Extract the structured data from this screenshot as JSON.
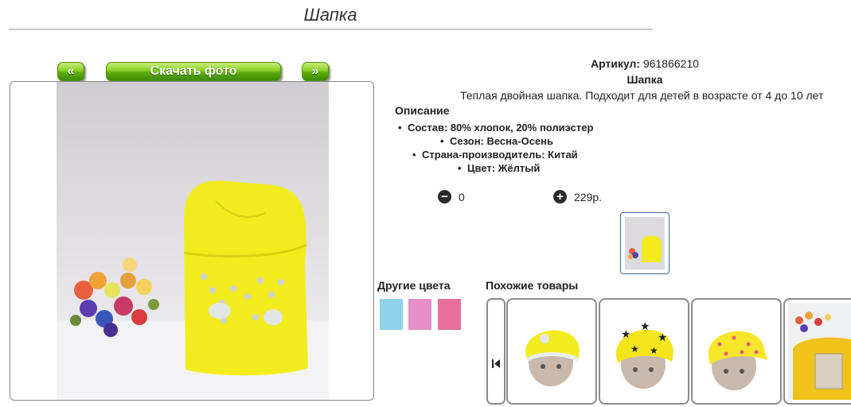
{
  "page": {
    "title": "Шапка"
  },
  "gallery": {
    "prev_label": "«",
    "download_label": "Скачать фото",
    "next_label": "»"
  },
  "product": {
    "article_label": "Артикул:",
    "article_value": "961866210",
    "name": "Шапка",
    "summary": "Теплая двойная шапка. Подходит для детей в возрасте от 4 до 10 лет",
    "description_heading": "Описание",
    "specs": [
      "Состав: 80% хлопок, 20% полиэстер",
      "Сезон: Весна-Осень",
      "Страна-производитель: Китай",
      "Цвет: Жёлтый"
    ]
  },
  "cart": {
    "minus_icon": "minus-circle-icon",
    "plus_icon": "plus-circle-icon",
    "quantity": "0",
    "price": "229р."
  },
  "other_colors": {
    "heading": "Другие цвета",
    "swatches": [
      "#8fd3ea",
      "#e48fc8",
      "#e76f9a"
    ]
  },
  "similar": {
    "heading": "Похожие товары",
    "prev_icon": "skip-back-icon"
  },
  "colors": {
    "accent_green": "#5fae0c",
    "hat_yellow": "#f2ec1e"
  }
}
